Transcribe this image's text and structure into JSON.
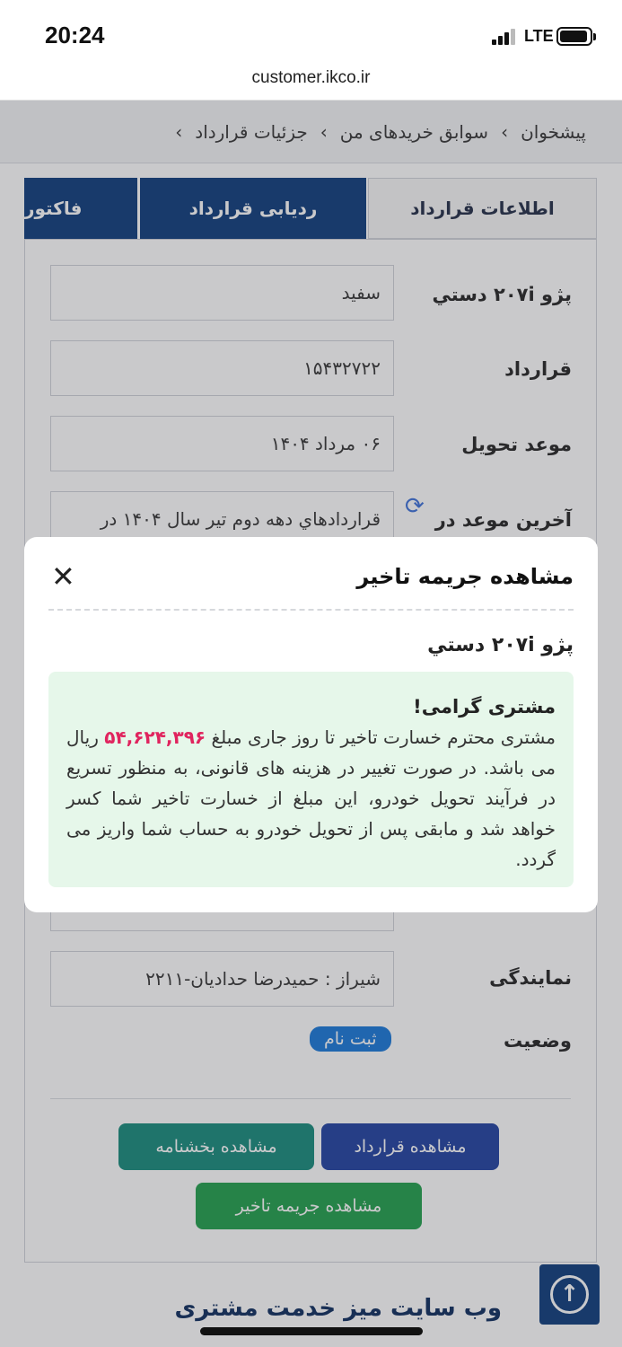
{
  "status": {
    "time": "20:24",
    "network": "LTE"
  },
  "browser": {
    "url": "customer.ikco.ir"
  },
  "breadcrumb": {
    "items": [
      "پیشخوان",
      "سوابق خریدهای من",
      "جزئیات قرارداد"
    ]
  },
  "tabs": [
    {
      "label": "اطلاعات قرارداد"
    },
    {
      "label": "ردیابی قرارداد"
    },
    {
      "label": "فاکتور"
    }
  ],
  "details": {
    "car": {
      "label": "پژو ۲۰۷i دستي",
      "value": "سفيد"
    },
    "contract": {
      "label": "قرارداد",
      "value": "۱۵۴۳۲۷۲۲"
    },
    "delivery": {
      "label": "موعد تحویل",
      "value": "۰۶ مرداد ۱۴۰۴"
    },
    "last_delivery": {
      "label": "آخرین موعد در",
      "value": "قراردادهاي دهه دوم تير سال ۱۴۰۴ در"
    },
    "agency": {
      "label": "نمایندگی",
      "value": "شیراز : حمیدرضا حدادیان-۲۲۱۱"
    },
    "status": {
      "label": "وضعیت",
      "value": "ثبت نام"
    }
  },
  "buttons": {
    "view_contract": "مشاهده قرارداد",
    "view_circular": "مشاهده بخشنامه",
    "view_penalty": "مشاهده جریمه تاخیر"
  },
  "footer": {
    "title": "وب سایت میز خدمت مشتری"
  },
  "modal": {
    "title": "مشاهده جریمه تاخیر",
    "car": "پژو ۲۰۷i دستي",
    "notice_title": "مشتری گرامی!",
    "text_before": "مشتری محترم خسارت تاخیر تا روز جاری مبلغ",
    "amount": "۵۴,۶۲۴,۳۹۶",
    "text_after": "ریال می باشد. در صورت تغییر در هزینه های قانونی، به منظور تسریع در فرآیند تحویل خودرو، این مبلغ از خسارت تاخیر شما کسر خواهد شد و مابقی پس از تحویل خودرو به حساب شما واریز می گردد."
  },
  "colors": {
    "primary": "#0b3a7a",
    "contract_button": "#1e3fa0",
    "circular_button": "#148a7a",
    "penalty_button": "#1e9e4a",
    "notice_bg": "#e6f7ea",
    "amount": "#e0245e",
    "badge": "#1677d9"
  },
  "icons": {
    "close": "close-icon",
    "refresh": "refresh-icon",
    "scroll_top": "arrow-up-circle-icon",
    "chevron": "chevron-left-icon"
  }
}
